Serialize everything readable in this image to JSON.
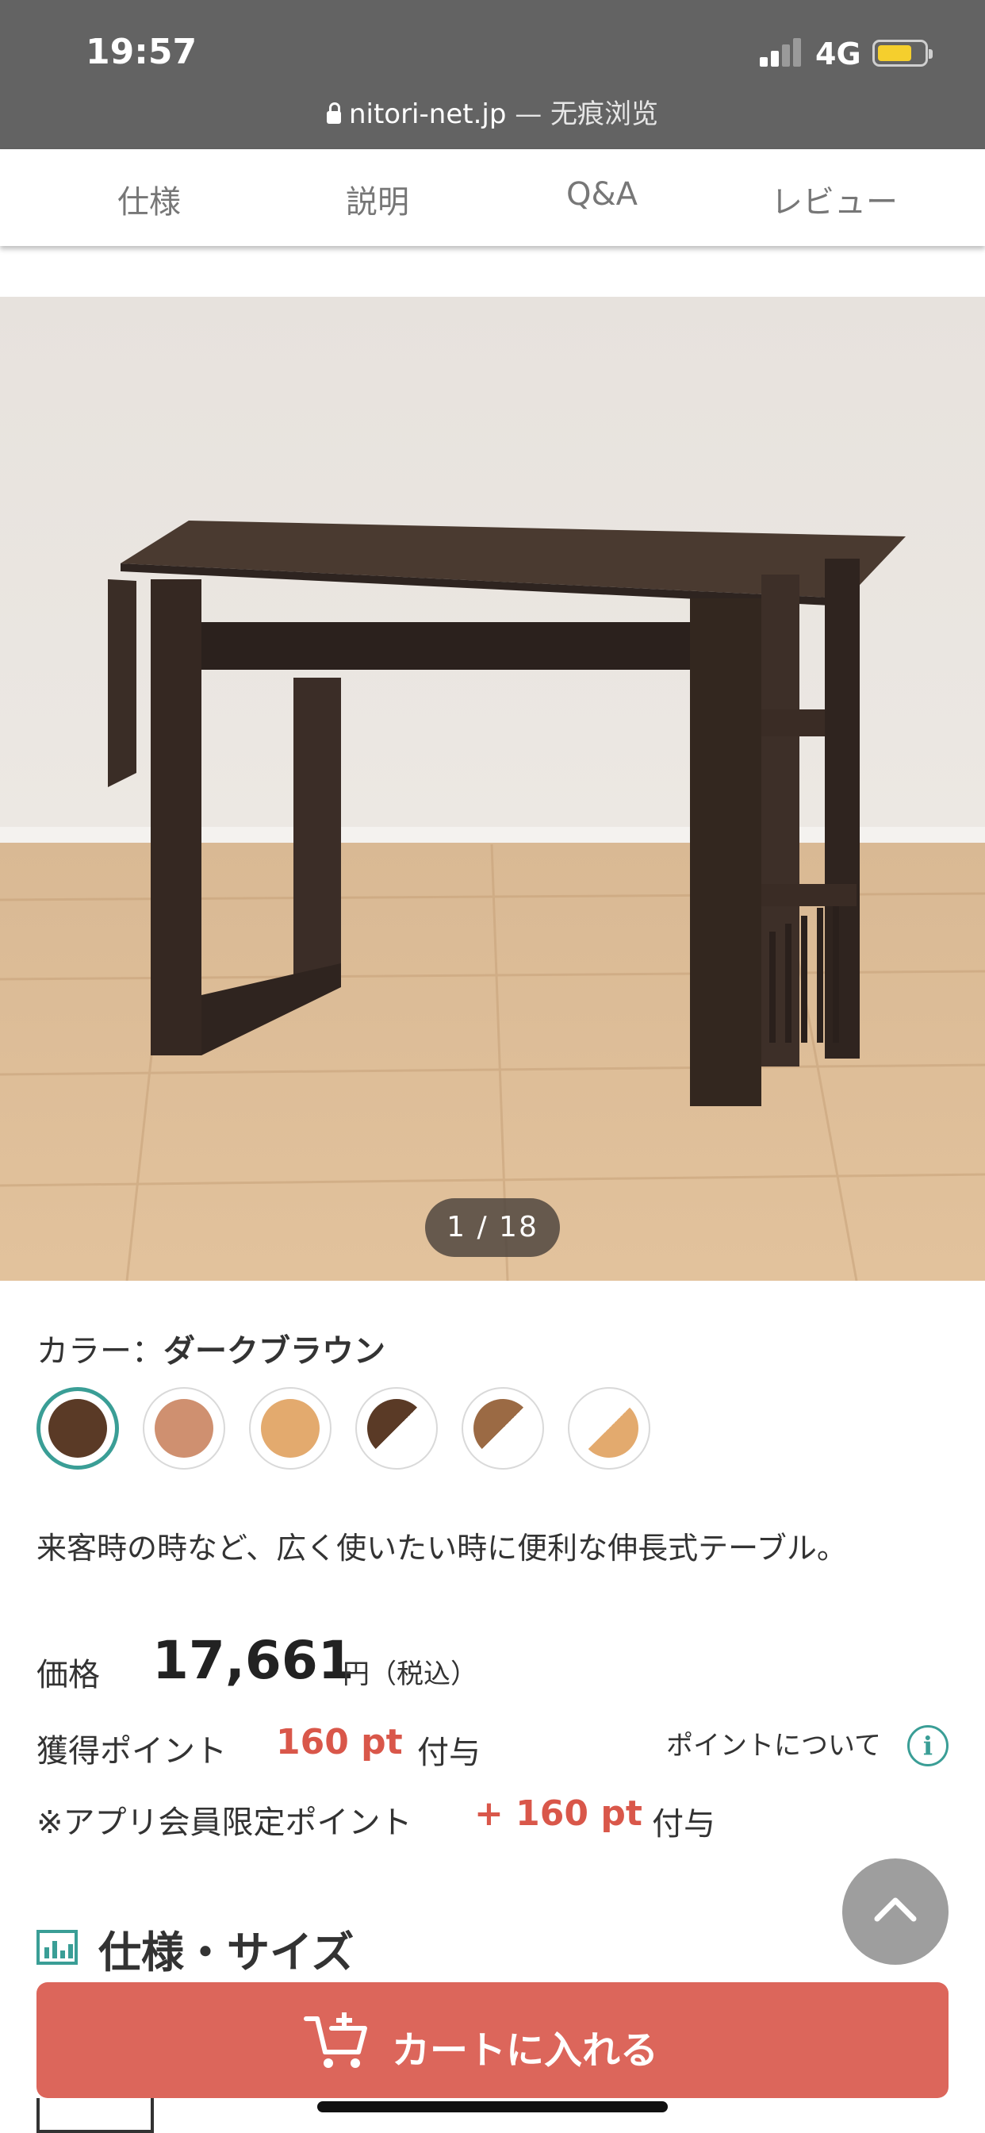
{
  "status_bar": {
    "time": "19:57",
    "network": "4G"
  },
  "browser": {
    "domain": "nitori-net.jp",
    "mode": " — 无痕浏览"
  },
  "tabs": [
    {
      "label": "仕様"
    },
    {
      "label": "説明"
    },
    {
      "label": "Q&A"
    },
    {
      "label": "レビュー"
    }
  ],
  "gallery": {
    "counter": "1 / 18"
  },
  "color": {
    "label": "カラー：",
    "selected_name": "ダークブラウン",
    "swatches": [
      {
        "fill": "#5a3a26",
        "selected": true
      },
      {
        "fill": "#cf9070"
      },
      {
        "fill": "#e3aa6e"
      },
      {
        "fill": "#5a3a26",
        "split": "#ffffff"
      },
      {
        "fill": "#9b6a44",
        "split": "#ffffff"
      },
      {
        "fill": "#e3aa6e",
        "split": "#ffffff"
      }
    ]
  },
  "description": "来客時の時など、広く使いたい時に便利な伸長式テーブル。",
  "price": {
    "label": "価格",
    "value": "17,661",
    "unit": "円（税込）"
  },
  "points": {
    "earned_label": "獲得ポイント",
    "earned_value": "160 pt",
    "earned_suffix": "付与",
    "link_text": "ポイントについて",
    "app_label": "※アプリ会員限定ポイント",
    "app_value": "+ 160 pt",
    "app_suffix": "付与"
  },
  "section": {
    "title": "仕様・サイズ"
  },
  "cart_button": {
    "label": "カートに入れる"
  },
  "colors": {
    "accent": "#3a9e96",
    "price_red": "#d9574a",
    "cart": "#dc665b"
  }
}
